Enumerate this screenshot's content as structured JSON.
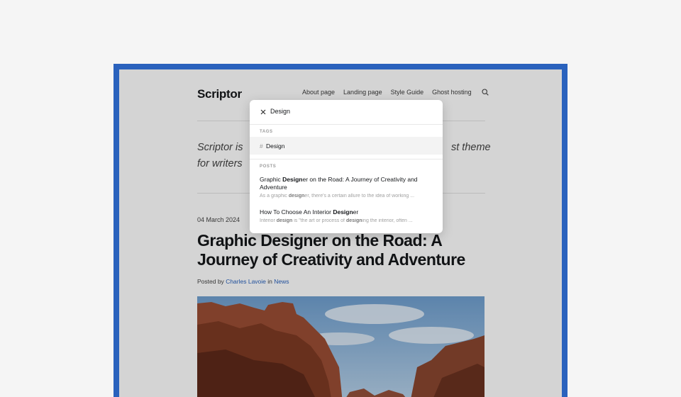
{
  "site": {
    "logo": "Scriptor",
    "nav": [
      "About page",
      "Landing page",
      "Style Guide",
      "Ghost hosting"
    ],
    "tagline_left_1": "Scriptor is",
    "tagline_right_1": "st theme",
    "tagline_left_2": "for writers"
  },
  "article": {
    "date": "04 March 2024",
    "title": "Graphic Designer on the Road: A Journey of Creativity and Adventure",
    "byline_prefix": "Posted by",
    "author": "Charles Lavoie",
    "byline_in": "in",
    "category": "News"
  },
  "search_popup": {
    "query": "Design",
    "tags_label": "TAGS",
    "tag_hash": "#",
    "tag": "Design",
    "posts_label": "POSTS",
    "posts": [
      {
        "title_before": "Graphic ",
        "title_match": "Design",
        "title_after": "er on the Road: A Journey of Creativity and Adventure",
        "excerpt_before": "As a graphic ",
        "excerpt_match": "design",
        "excerpt_after": "er, there's a certain allure to the idea of working ..."
      },
      {
        "title_before": "How To Choose An Interior ",
        "title_match": "Design",
        "title_after": "er",
        "excerpt_before": "Interior ",
        "excerpt_match": "design",
        "excerpt_middle": " is \"the art or process of ",
        "excerpt_match2": "design",
        "excerpt_after": "ing the interior, often ..."
      }
    ]
  },
  "colors": {
    "frame": "#2a62bd",
    "link": "#2a62bd"
  }
}
